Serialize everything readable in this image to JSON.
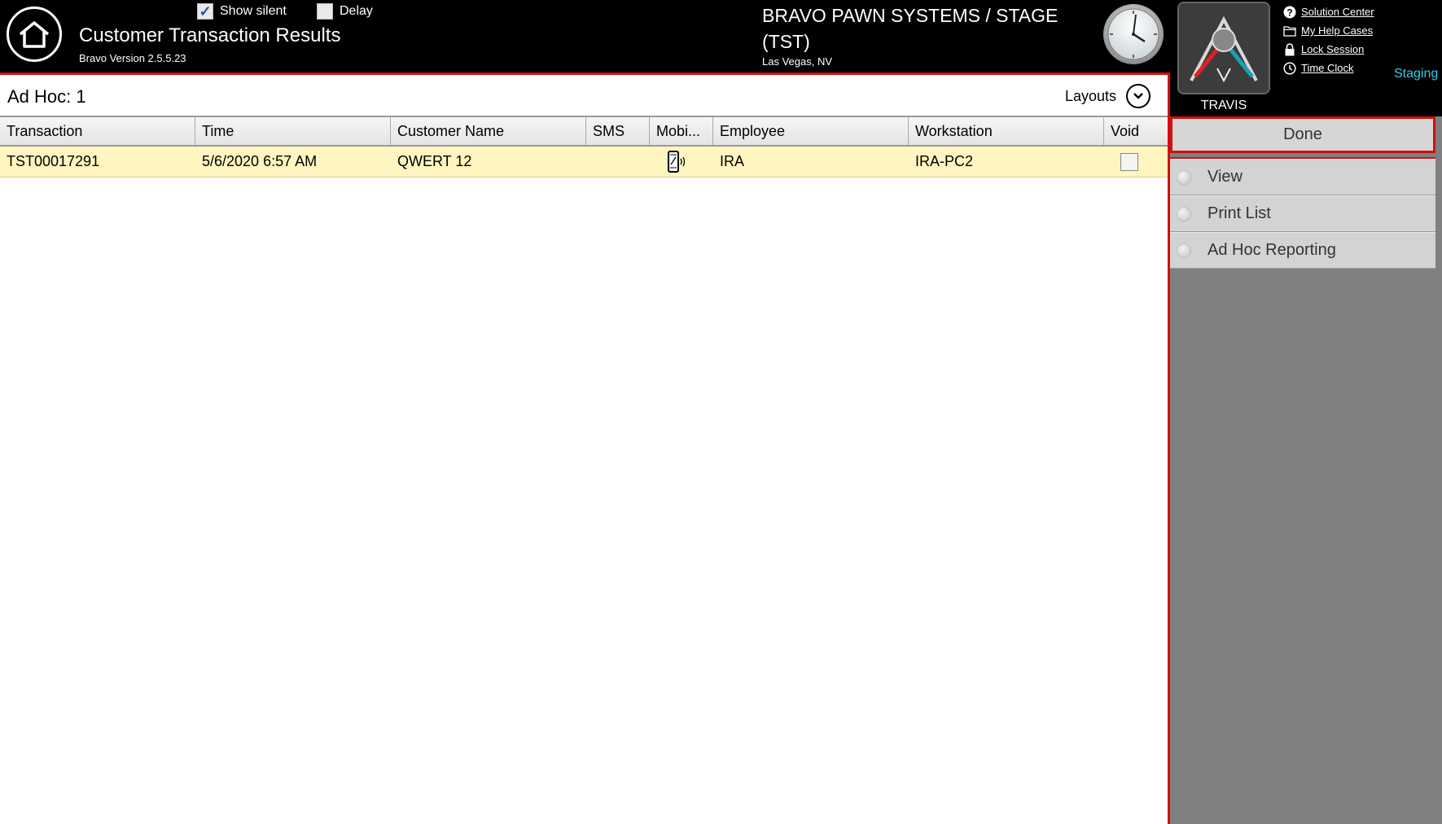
{
  "header": {
    "title": "Customer Transaction Results",
    "version": "Bravo Version 2.5.5.23",
    "show_silent": {
      "label": "Show silent",
      "checked": true
    },
    "delay": {
      "label": "Delay",
      "checked": false
    },
    "company": "BRAVO PAWN SYSTEMS / STAGE (TST)",
    "location": "Las Vegas, NV",
    "username": "TRAVIS",
    "environment": "Staging",
    "links": [
      {
        "label": "Solution Center",
        "icon": "help-circle-icon"
      },
      {
        "label": "My Help Cases",
        "icon": "folder-icon"
      },
      {
        "label": "Lock Session",
        "icon": "lock-icon"
      },
      {
        "label": "Time Clock",
        "icon": "clock-icon"
      }
    ]
  },
  "main": {
    "adhoc_label": "Ad Hoc:  1",
    "layouts_label": "Layouts",
    "columns": [
      "Transaction",
      "Time",
      "Customer Name",
      "SMS",
      "Mobi...",
      "Employee",
      "Workstation",
      "Void"
    ],
    "rows": [
      {
        "transaction": "TST00017291",
        "time": "5/6/2020 6:57 AM",
        "customer": "QWERT 12",
        "sms": "",
        "mobile_icon": "mobile-phone-icon",
        "employee": "IRA",
        "workstation": "IRA-PC2",
        "void": false
      }
    ]
  },
  "side": {
    "done_label": "Done",
    "menu": [
      "View",
      "Print List",
      "Ad Hoc Reporting"
    ]
  },
  "colors": {
    "accent_red": "#d01010",
    "staging_cyan": "#28d0ec",
    "row_highlight": "#fff5c0",
    "panel_gray": "#808080"
  }
}
